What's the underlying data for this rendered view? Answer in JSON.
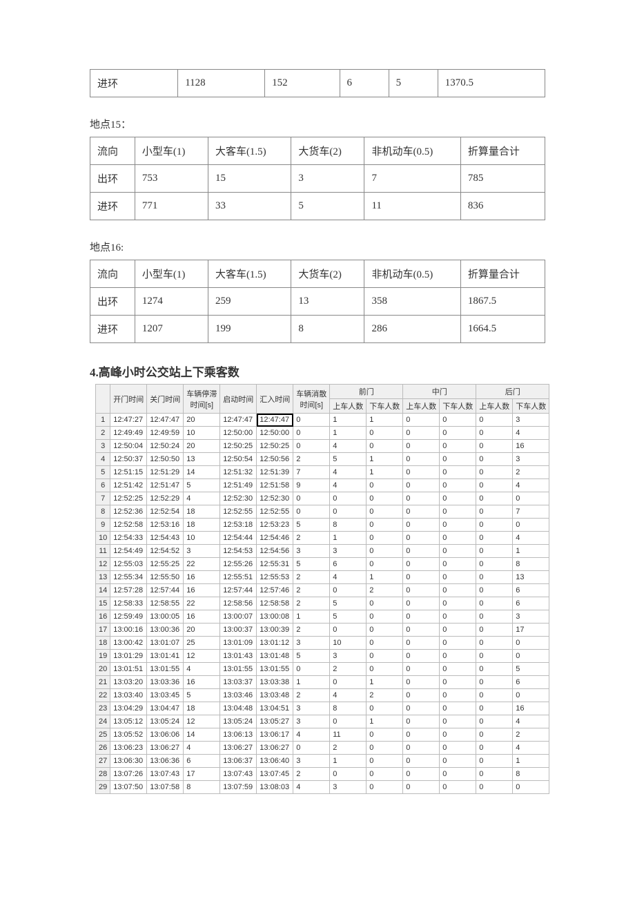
{
  "table14": {
    "rows": [
      {
        "dir": "进环",
        "small": "1128",
        "bus": "152",
        "truck": "6",
        "nonmotor": "5",
        "total": "1370.5"
      }
    ]
  },
  "label15": "地点15：",
  "table15": {
    "headers": [
      "流向",
      "小型车(1)",
      "大客车(1.5)",
      "大货车(2)",
      "非机动车(0.5)",
      "折算量合计"
    ],
    "rows": [
      {
        "dir": "出环",
        "small": "753",
        "bus": "15",
        "truck": "3",
        "nonmotor": "7",
        "total": "785"
      },
      {
        "dir": "进环",
        "small": "771",
        "bus": "33",
        "truck": "5",
        "nonmotor": "11",
        "total": "836"
      }
    ]
  },
  "label16": "地点16:",
  "table16": {
    "headers": [
      "流向",
      "小型车(1)",
      "大客车(1.5)",
      "大货车(2)",
      "非机动车(0.5)",
      "折算量合计"
    ],
    "rows": [
      {
        "dir": "出环",
        "small": "1274",
        "bus": "259",
        "truck": "13",
        "nonmotor": "358",
        "total": "1867.5"
      },
      {
        "dir": "进环",
        "small": "1207",
        "bus": "199",
        "truck": "8",
        "nonmotor": "286",
        "total": "1664.5"
      }
    ]
  },
  "heading4": "4.高峰小时公交站上下乘客数",
  "bus": {
    "top_headers": {
      "open": "开门时间",
      "close": "关门时间",
      "stop": "车辆停滞\n时间[s]",
      "start": "启动时间",
      "merge": "汇入时间",
      "clear": "车辆消散\n时间[s]",
      "front": "前门",
      "mid": "中门",
      "rear": "后门"
    },
    "sub_headers": {
      "on": "上车人数",
      "off": "下车人数"
    },
    "rows": [
      {
        "n": 1,
        "open": "12:47:27",
        "close": "12:47:47",
        "stop": "20",
        "start": "12:47:47",
        "merge": "12:47:47",
        "clear": "0",
        "fo": "1",
        "ff": "1",
        "mo": "0",
        "mf": "0",
        "ro": "0",
        "rf": "3"
      },
      {
        "n": 2,
        "open": "12:49:49",
        "close": "12:49:59",
        "stop": "10",
        "start": "12:50:00",
        "merge": "12:50:00",
        "clear": "0",
        "fo": "1",
        "ff": "0",
        "mo": "0",
        "mf": "0",
        "ro": "0",
        "rf": "4"
      },
      {
        "n": 3,
        "open": "12:50:04",
        "close": "12:50:24",
        "stop": "20",
        "start": "12:50:25",
        "merge": "12:50:25",
        "clear": "0",
        "fo": "4",
        "ff": "0",
        "mo": "0",
        "mf": "0",
        "ro": "0",
        "rf": "16"
      },
      {
        "n": 4,
        "open": "12:50:37",
        "close": "12:50:50",
        "stop": "13",
        "start": "12:50:54",
        "merge": "12:50:56",
        "clear": "2",
        "fo": "5",
        "ff": "1",
        "mo": "0",
        "mf": "0",
        "ro": "0",
        "rf": "3"
      },
      {
        "n": 5,
        "open": "12:51:15",
        "close": "12:51:29",
        "stop": "14",
        "start": "12:51:32",
        "merge": "12:51:39",
        "clear": "7",
        "fo": "4",
        "ff": "1",
        "mo": "0",
        "mf": "0",
        "ro": "0",
        "rf": "2"
      },
      {
        "n": 6,
        "open": "12:51:42",
        "close": "12:51:47",
        "stop": "5",
        "start": "12:51:49",
        "merge": "12:51:58",
        "clear": "9",
        "fo": "4",
        "ff": "0",
        "mo": "0",
        "mf": "0",
        "ro": "0",
        "rf": "4"
      },
      {
        "n": 7,
        "open": "12:52:25",
        "close": "12:52:29",
        "stop": "4",
        "start": "12:52:30",
        "merge": "12:52:30",
        "clear": "0",
        "fo": "0",
        "ff": "0",
        "mo": "0",
        "mf": "0",
        "ro": "0",
        "rf": "0"
      },
      {
        "n": 8,
        "open": "12:52:36",
        "close": "12:52:54",
        "stop": "18",
        "start": "12:52:55",
        "merge": "12:52:55",
        "clear": "0",
        "fo": "0",
        "ff": "0",
        "mo": "0",
        "mf": "0",
        "ro": "0",
        "rf": "7"
      },
      {
        "n": 9,
        "open": "12:52:58",
        "close": "12:53:16",
        "stop": "18",
        "start": "12:53:18",
        "merge": "12:53:23",
        "clear": "5",
        "fo": "8",
        "ff": "0",
        "mo": "0",
        "mf": "0",
        "ro": "0",
        "rf": "0"
      },
      {
        "n": 10,
        "open": "12:54:33",
        "close": "12:54:43",
        "stop": "10",
        "start": "12:54:44",
        "merge": "12:54:46",
        "clear": "2",
        "fo": "1",
        "ff": "0",
        "mo": "0",
        "mf": "0",
        "ro": "0",
        "rf": "4"
      },
      {
        "n": 11,
        "open": "12:54:49",
        "close": "12:54:52",
        "stop": "3",
        "start": "12:54:53",
        "merge": "12:54:56",
        "clear": "3",
        "fo": "3",
        "ff": "0",
        "mo": "0",
        "mf": "0",
        "ro": "0",
        "rf": "1"
      },
      {
        "n": 12,
        "open": "12:55:03",
        "close": "12:55:25",
        "stop": "22",
        "start": "12:55:26",
        "merge": "12:55:31",
        "clear": "5",
        "fo": "6",
        "ff": "0",
        "mo": "0",
        "mf": "0",
        "ro": "0",
        "rf": "8"
      },
      {
        "n": 13,
        "open": "12:55:34",
        "close": "12:55:50",
        "stop": "16",
        "start": "12:55:51",
        "merge": "12:55:53",
        "clear": "2",
        "fo": "4",
        "ff": "1",
        "mo": "0",
        "mf": "0",
        "ro": "0",
        "rf": "13"
      },
      {
        "n": 14,
        "open": "12:57:28",
        "close": "12:57:44",
        "stop": "16",
        "start": "12:57:44",
        "merge": "12:57:46",
        "clear": "2",
        "fo": "0",
        "ff": "2",
        "mo": "0",
        "mf": "0",
        "ro": "0",
        "rf": "6"
      },
      {
        "n": 15,
        "open": "12:58:33",
        "close": "12:58:55",
        "stop": "22",
        "start": "12:58:56",
        "merge": "12:58:58",
        "clear": "2",
        "fo": "5",
        "ff": "0",
        "mo": "0",
        "mf": "0",
        "ro": "0",
        "rf": "6"
      },
      {
        "n": 16,
        "open": "12:59:49",
        "close": "13:00:05",
        "stop": "16",
        "start": "13:00:07",
        "merge": "13:00:08",
        "clear": "1",
        "fo": "5",
        "ff": "0",
        "mo": "0",
        "mf": "0",
        "ro": "0",
        "rf": "3"
      },
      {
        "n": 17,
        "open": "13:00:16",
        "close": "13:00:36",
        "stop": "20",
        "start": "13:00:37",
        "merge": "13:00:39",
        "clear": "2",
        "fo": "0",
        "ff": "0",
        "mo": "0",
        "mf": "0",
        "ro": "0",
        "rf": "17"
      },
      {
        "n": 18,
        "open": "13:00:42",
        "close": "13:01:07",
        "stop": "25",
        "start": "13:01:09",
        "merge": "13:01:12",
        "clear": "3",
        "fo": "10",
        "ff": "0",
        "mo": "0",
        "mf": "0",
        "ro": "0",
        "rf": "0"
      },
      {
        "n": 19,
        "open": "13:01:29",
        "close": "13:01:41",
        "stop": "12",
        "start": "13:01:43",
        "merge": "13:01:48",
        "clear": "5",
        "fo": "3",
        "ff": "0",
        "mo": "0",
        "mf": "0",
        "ro": "0",
        "rf": "0"
      },
      {
        "n": 20,
        "open": "13:01:51",
        "close": "13:01:55",
        "stop": "4",
        "start": "13:01:55",
        "merge": "13:01:55",
        "clear": "0",
        "fo": "2",
        "ff": "0",
        "mo": "0",
        "mf": "0",
        "ro": "0",
        "rf": "5"
      },
      {
        "n": 21,
        "open": "13:03:20",
        "close": "13:03:36",
        "stop": "16",
        "start": "13:03:37",
        "merge": "13:03:38",
        "clear": "1",
        "fo": "0",
        "ff": "1",
        "mo": "0",
        "mf": "0",
        "ro": "0",
        "rf": "6"
      },
      {
        "n": 22,
        "open": "13:03:40",
        "close": "13:03:45",
        "stop": "5",
        "start": "13:03:46",
        "merge": "13:03:48",
        "clear": "2",
        "fo": "4",
        "ff": "2",
        "mo": "0",
        "mf": "0",
        "ro": "0",
        "rf": "0"
      },
      {
        "n": 23,
        "open": "13:04:29",
        "close": "13:04:47",
        "stop": "18",
        "start": "13:04:48",
        "merge": "13:04:51",
        "clear": "3",
        "fo": "8",
        "ff": "0",
        "mo": "0",
        "mf": "0",
        "ro": "0",
        "rf": "16"
      },
      {
        "n": 24,
        "open": "13:05:12",
        "close": "13:05:24",
        "stop": "12",
        "start": "13:05:24",
        "merge": "13:05:27",
        "clear": "3",
        "fo": "0",
        "ff": "1",
        "mo": "0",
        "mf": "0",
        "ro": "0",
        "rf": "4"
      },
      {
        "n": 25,
        "open": "13:05:52",
        "close": "13:06:06",
        "stop": "14",
        "start": "13:06:13",
        "merge": "13:06:17",
        "clear": "4",
        "fo": "11",
        "ff": "0",
        "mo": "0",
        "mf": "0",
        "ro": "0",
        "rf": "2"
      },
      {
        "n": 26,
        "open": "13:06:23",
        "close": "13:06:27",
        "stop": "4",
        "start": "13:06:27",
        "merge": "13:06:27",
        "clear": "0",
        "fo": "2",
        "ff": "0",
        "mo": "0",
        "mf": "0",
        "ro": "0",
        "rf": "4"
      },
      {
        "n": 27,
        "open": "13:06:30",
        "close": "13:06:36",
        "stop": "6",
        "start": "13:06:37",
        "merge": "13:06:40",
        "clear": "3",
        "fo": "1",
        "ff": "0",
        "mo": "0",
        "mf": "0",
        "ro": "0",
        "rf": "1"
      },
      {
        "n": 28,
        "open": "13:07:26",
        "close": "13:07:43",
        "stop": "17",
        "start": "13:07:43",
        "merge": "13:07:45",
        "clear": "2",
        "fo": "0",
        "ff": "0",
        "mo": "0",
        "mf": "0",
        "ro": "0",
        "rf": "8"
      },
      {
        "n": 29,
        "open": "13:07:50",
        "close": "13:07:58",
        "stop": "8",
        "start": "13:07:59",
        "merge": "13:08:03",
        "clear": "4",
        "fo": "3",
        "ff": "0",
        "mo": "0",
        "mf": "0",
        "ro": "0",
        "rf": "0"
      }
    ],
    "selected_cell": {
      "row": 1,
      "col": "merge"
    }
  }
}
